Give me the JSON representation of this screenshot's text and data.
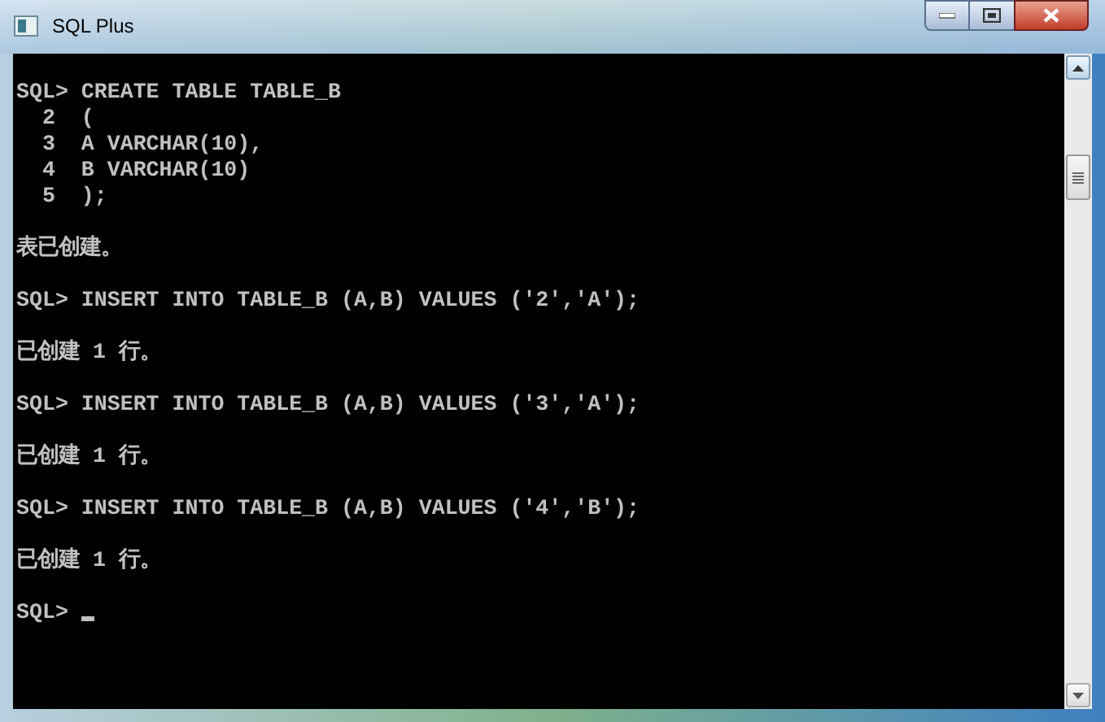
{
  "window": {
    "title": "SQL Plus"
  },
  "console": {
    "lines": [
      {
        "kind": "blank"
      },
      {
        "kind": "text",
        "text": "SQL> CREATE TABLE TABLE_B"
      },
      {
        "kind": "text",
        "text": "  2  ("
      },
      {
        "kind": "text",
        "text": "  3  A VARCHAR(10),"
      },
      {
        "kind": "text",
        "text": "  4  B VARCHAR(10)"
      },
      {
        "kind": "text",
        "text": "  5  );"
      },
      {
        "kind": "blank"
      },
      {
        "kind": "text",
        "text": "表已创建。"
      },
      {
        "kind": "blank"
      },
      {
        "kind": "text",
        "text": "SQL> INSERT INTO TABLE_B (A,B) VALUES ('2','A');"
      },
      {
        "kind": "blank"
      },
      {
        "kind": "text",
        "text": "已创建 1 行。"
      },
      {
        "kind": "blank"
      },
      {
        "kind": "text",
        "text": "SQL> INSERT INTO TABLE_B (A,B) VALUES ('3','A');"
      },
      {
        "kind": "blank"
      },
      {
        "kind": "text",
        "text": "已创建 1 行。"
      },
      {
        "kind": "blank"
      },
      {
        "kind": "text",
        "text": "SQL> INSERT INTO TABLE_B (A,B) VALUES ('4','B');"
      },
      {
        "kind": "blank"
      },
      {
        "kind": "text",
        "text": "已创建 1 行。"
      },
      {
        "kind": "blank"
      },
      {
        "kind": "prompt",
        "text": "SQL>"
      }
    ]
  }
}
